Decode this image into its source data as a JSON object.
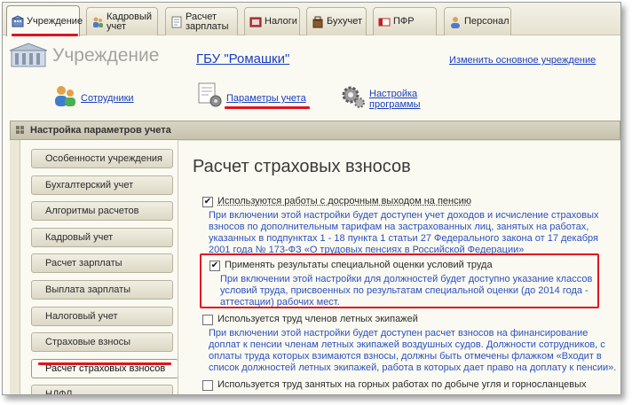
{
  "tabs": [
    {
      "label": "Учреждение",
      "icon": "building-icon"
    },
    {
      "label": "Кадровый учет",
      "icon": "personnel-icon"
    },
    {
      "label": "Расчет зарплаты",
      "icon": "payroll-icon"
    },
    {
      "label": "Налоги",
      "icon": "taxes-icon"
    },
    {
      "label": "Бухучет",
      "icon": "accounting-icon"
    },
    {
      "label": "ПФР",
      "icon": "pension-fund-icon"
    },
    {
      "label": "Персонал",
      "icon": "staff-icon"
    }
  ],
  "header": {
    "title": "Учреждение",
    "organization": "ГБУ \"Ромашки\"",
    "change_link": "Изменить основное учреждение"
  },
  "nav": {
    "employees": "Сотрудники",
    "accounting_params": "Параметры учета",
    "program_settings": "Настройка программы"
  },
  "panel": {
    "title": "Настройка параметров учета"
  },
  "sidebar": {
    "items": [
      "Особенности учреждения",
      "Бухгалтерский учет",
      "Алгоритмы расчетов",
      "Кадровый учет",
      "Расчет зарплаты",
      "Выплата зарплаты",
      "Налоговый учет",
      "Страховые взносы",
      "Расчет страховых взносов",
      "НДФЛ"
    ],
    "active_index": 8
  },
  "content": {
    "title": "Расчет страховых взносов",
    "options": [
      {
        "label": "Используются работы с досрочным выходом на пенсию",
        "checked": true,
        "description": "При включении этой настройки будет доступен учет доходов и исчисление страховых взносов по дополнительным тарифам на застрахованных лиц, занятых на работах, указанных в подпунктах 1 - 18 пункта 1 статьи 27 Федерального закона от 17 декабря 2001 года № 173-ФЗ «О трудовых пенсиях в Российской Федерации»"
      },
      {
        "label": "Применять результаты специальной оценки условий труда",
        "checked": true,
        "description": "При включении этой настройки для должностей будет доступно указание классов условий труда, присвоенных по результатам специальной оценки (до 2014 года - аттестации) рабочих мест."
      },
      {
        "label": "Используется труд членов летных экипажей",
        "checked": false,
        "description": "При включении этой настройки будет доступен расчет взносов на финансирование доплат к пенсии членам летных экипажей воздушных судов. Должности сотрудников, с оплаты труда которых взимаются взносы, должны быть отмечены флажком «Входит в список должностей летных экипажей, работа в которых дает право на доплату к пенсии»."
      },
      {
        "label": "Используется труд занятых на горных работах по добыче угля и горносланцевых",
        "checked": false,
        "description": ""
      }
    ]
  },
  "colors": {
    "highlight": "#e0141e",
    "link": "#1a3ebf",
    "description_text": "#2b51c0"
  }
}
